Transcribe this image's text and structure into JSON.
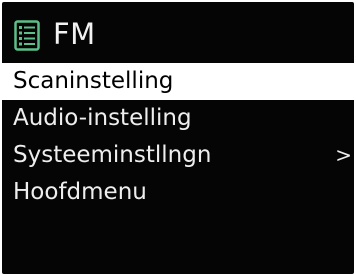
{
  "header": {
    "icon": "list-icon",
    "title": "FM"
  },
  "menu": {
    "items": [
      {
        "label": "Scaninstelling",
        "selected": true
      },
      {
        "label": "Audio-instelling",
        "selected": false
      },
      {
        "label": "Systeeminstllngn",
        "selected": false,
        "submenu_indicator": ">"
      },
      {
        "label": "Hoofdmenu",
        "selected": false
      }
    ]
  },
  "colors": {
    "screen_background": "#050505",
    "text": "#eeeeee",
    "selection_background": "#ffffff",
    "selection_text": "#000000",
    "icon_accent": "#5cc08a"
  }
}
